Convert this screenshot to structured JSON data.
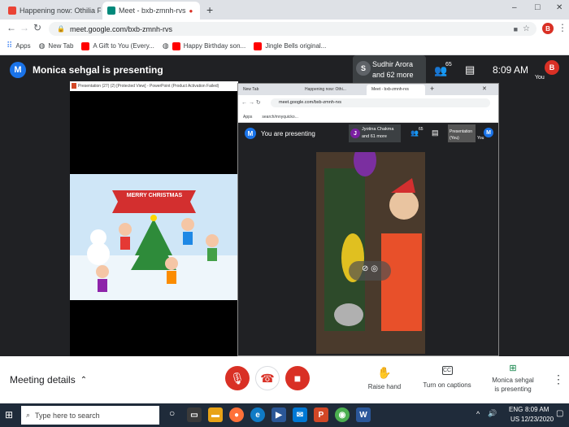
{
  "browser": {
    "tabs": [
      {
        "label": "Happening now: Othilia Fernand..."
      },
      {
        "label": "Meet - bxb-zmnh-rvs"
      }
    ],
    "url": "meet.google.com/bxb-zmnh-rvs",
    "bookmarks": [
      "Apps",
      "New Tab",
      "A Gift to You (Every...",
      "Happy Birthday son...",
      "Jingle Bells original..."
    ],
    "profile_initial": "B",
    "window": {
      "minimize": "–",
      "maximize": "□",
      "close": "✕"
    }
  },
  "meet": {
    "presenter_initial": "M",
    "presenter_text": "Monica sehgal is presenting",
    "participant_initial": "S",
    "participant_name": "Sudhir Arora",
    "participant_more": "and 62 more",
    "people_count": "65",
    "time": "8:09 AM",
    "you_label": "You",
    "you_initial": "B"
  },
  "presentation": {
    "window_title": "Presentation (27) (2) [Protected View] - PowerPoint (Product Activation Failed)",
    "slide_banner": "MERRY CHRISTMAS"
  },
  "inner": {
    "tabs": [
      "New Tab",
      "Happening now: Othi...",
      "Meet - bxb-zmnh-rvs"
    ],
    "url": "meet.google.com/bxb-zmnh-rvs",
    "bookmarks": [
      "Apps",
      "search/mnyquicko..."
    ],
    "presenting_initial": "M",
    "presenting_text": "You are presenting",
    "participant_initial": "J",
    "participant_name": "Jyotina Chakma",
    "participant_more": "and 61 more",
    "people_count": "65",
    "presentation_label": "Presentation",
    "you_label": "(You)",
    "you_text": "You",
    "you_initial": "M"
  },
  "bottom": {
    "meeting_details": "Meeting details",
    "raise_hand": "Raise hand",
    "captions": "Turn on captions",
    "captions_icon": "CC",
    "presenting_line1": "Monica sehgal",
    "presenting_line2": "is presenting"
  },
  "taskbar": {
    "search_placeholder": "Type here to search",
    "lang": "ENG",
    "region": "US",
    "time": "8:09 AM",
    "date": "12/23/2020"
  },
  "colors": {
    "meet_blue": "#1a73e8",
    "red": "#d93025",
    "dark": "#202124"
  }
}
